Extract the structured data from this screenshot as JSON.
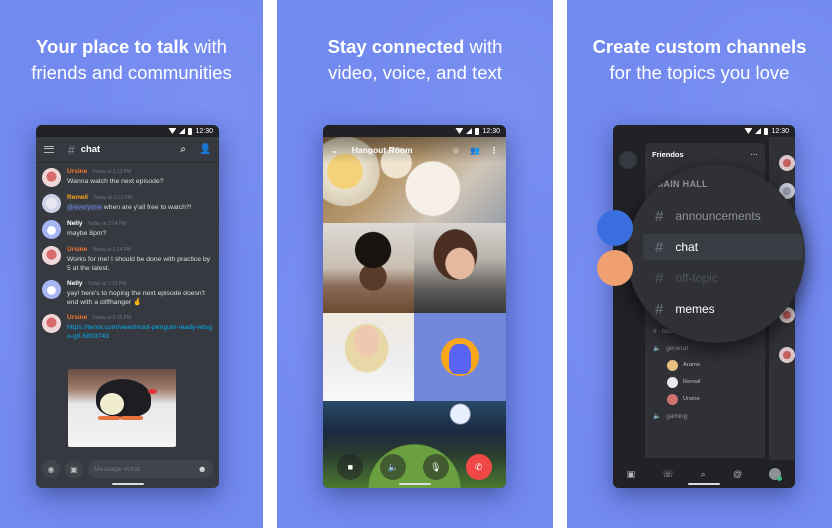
{
  "panels": [
    {
      "headline_bold": "Your place to talk",
      "headline_rest": " with",
      "subline": "friends and communities",
      "phone": {
        "status_time": "12:30",
        "channel": "chat",
        "messages": [
          {
            "author": "Ursine",
            "color": "#f57731",
            "time": "Today at 2:13 PM",
            "text": "Wanna watch the next episode?"
          },
          {
            "author": "Renwil",
            "color": "#faa61a",
            "time": "Today at 2:13 PM",
            "mention": "@everyone",
            "text": " when are y'all free to watch?!"
          },
          {
            "author": "Nelly",
            "color": "#ffffff",
            "time": "Today at 2:14 PM",
            "text": "maybe 8pm?"
          },
          {
            "author": "Ursine",
            "color": "#f57731",
            "time": "Today at 2:14 PM",
            "text": "Works for me! I should be done with practice by 5 at the latest."
          },
          {
            "author": "Nelly",
            "color": "#ffffff",
            "time": "Today at 2:15 PM",
            "text": "yay! here's to hoping the next episode doesn't end with a cliffhanger 🤞"
          },
          {
            "author": "Ursine",
            "color": "#f57731",
            "time": "Today at 2:15 PM",
            "link": "https://tenor.com/view/moot-penguin-ready-letsgo-gif-5803743"
          }
        ],
        "input_placeholder": "Message #chat"
      }
    },
    {
      "headline_bold": "Stay connected",
      "headline_rest": " with",
      "subline": "video, voice, and text",
      "phone": {
        "status_time": "12:30",
        "room_title": "Hangout Room"
      }
    },
    {
      "headline_bold": "Create custom channels",
      "headline_rest": "",
      "subline": "for the topics you love",
      "phone": {
        "status_time": "12:30",
        "server_name": "Friendos",
        "category": "MAIN HALL",
        "channels": [
          {
            "name": "announcements",
            "state": "normal"
          },
          {
            "name": "chat",
            "state": "active"
          },
          {
            "name": "off-topic",
            "state": "muted"
          },
          {
            "name": "memes",
            "state": "unread"
          }
        ],
        "lower_channels": {
          "text": "music",
          "voice_general": "general",
          "voice_members": [
            "Arame",
            "Renwil",
            "Ursine"
          ],
          "voice_gaming": "gaming"
        }
      }
    }
  ]
}
